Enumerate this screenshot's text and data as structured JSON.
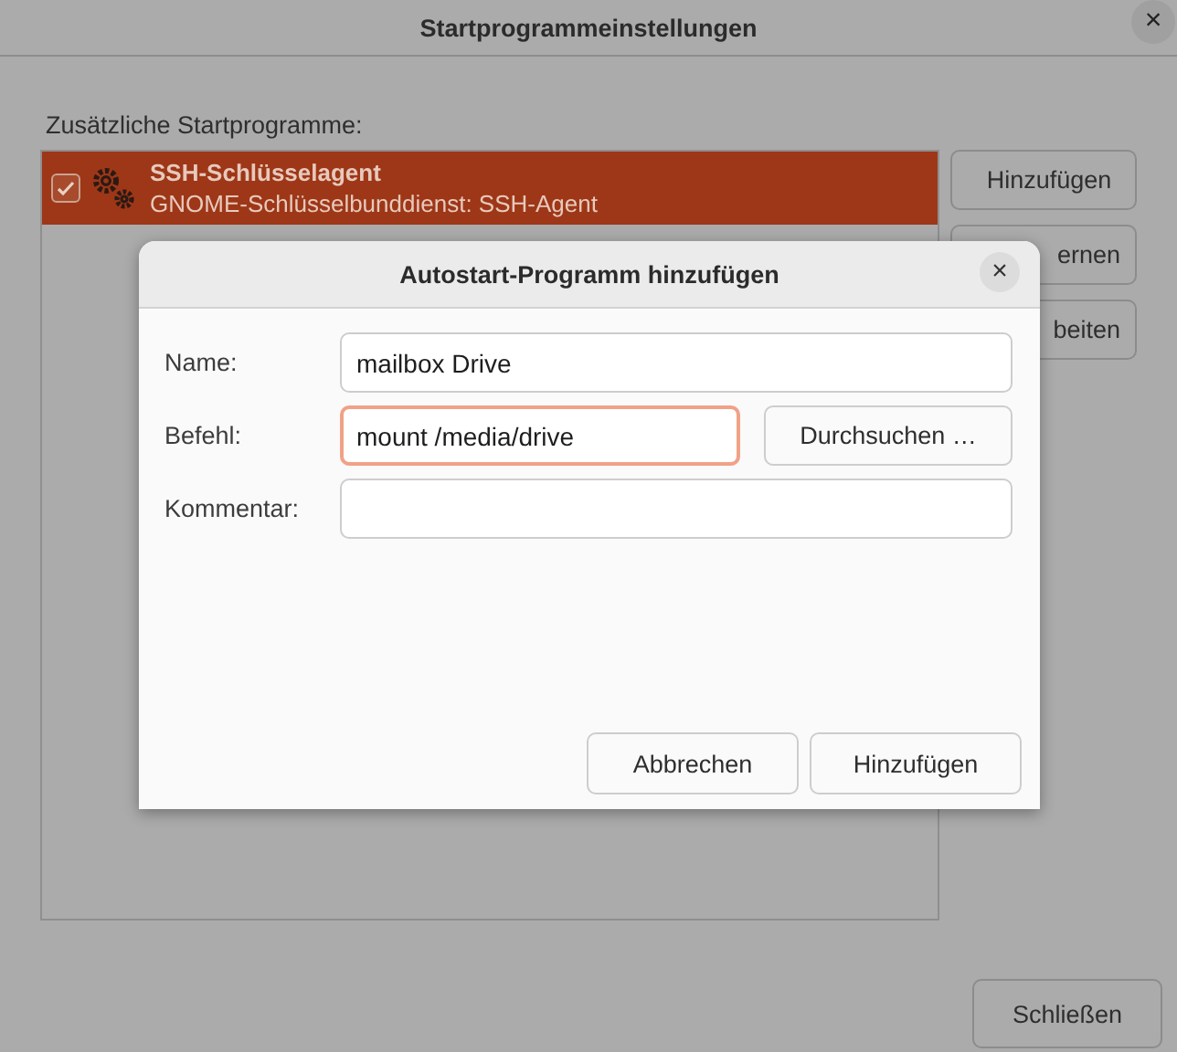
{
  "window": {
    "title": "Startprogrammeinstellungen",
    "close": "×"
  },
  "list_label": "Zusätzliche Startprogramme:",
  "programs": [
    {
      "name": "SSH-Schlüsselagent",
      "description": "GNOME-Schlüsselbunddienst: SSH-Agent",
      "checked": true,
      "selected": true
    }
  ],
  "side_buttons": [
    "Hinzufügen",
    "ernen",
    "beiten"
  ],
  "close_button": "Schließen",
  "dialog": {
    "title": "Autostart-Programm hinzufügen",
    "close": "×",
    "fields": [
      {
        "label": "Name:",
        "value": "mailbox Drive",
        "focused": false
      },
      {
        "label": "Befehl:",
        "value": "mount /media/drive",
        "focused": true,
        "button": "Durchsuchen …"
      },
      {
        "label": "Kommentar:",
        "focused": false
      }
    ],
    "buttons": [
      "Abbrechen",
      "Hinzufügen"
    ]
  }
}
